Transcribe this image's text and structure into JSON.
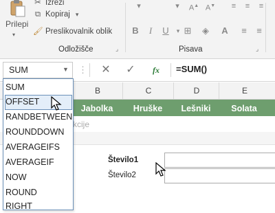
{
  "ribbon": {
    "paste_label": "Prilepi",
    "cut_label": "Izreži",
    "copy_label": "Kopiraj",
    "format_painter_label": "Preslikovalnik oblik",
    "clipboard_group": "Odložišče",
    "font_group": "Pisava"
  },
  "name_box": {
    "value": "SUM"
  },
  "formula_bar": {
    "fx_label": "fx",
    "formula": "=SUM()"
  },
  "columns": [
    "B",
    "C",
    "D",
    "E"
  ],
  "header_cells": [
    "Jabolka",
    "Hruške",
    "Lešniki",
    "Solata"
  ],
  "row2_text": "kcije",
  "function_list": [
    "SUM",
    "OFFSET",
    "RANDBETWEEN",
    "ROUNDDOWN",
    "AVERAGEIFS",
    "AVERAGEIF",
    "NOW",
    "ROUND",
    "RIGHT"
  ],
  "function_list_selected": "OFFSET",
  "arguments": [
    {
      "label": "Število1",
      "value": ""
    },
    {
      "label": "Število2",
      "value": ""
    }
  ],
  "colors": {
    "header_fill": "#6e9e6e",
    "accent_blue": "#6a8fb8",
    "fx_green": "#2f7d3a"
  }
}
